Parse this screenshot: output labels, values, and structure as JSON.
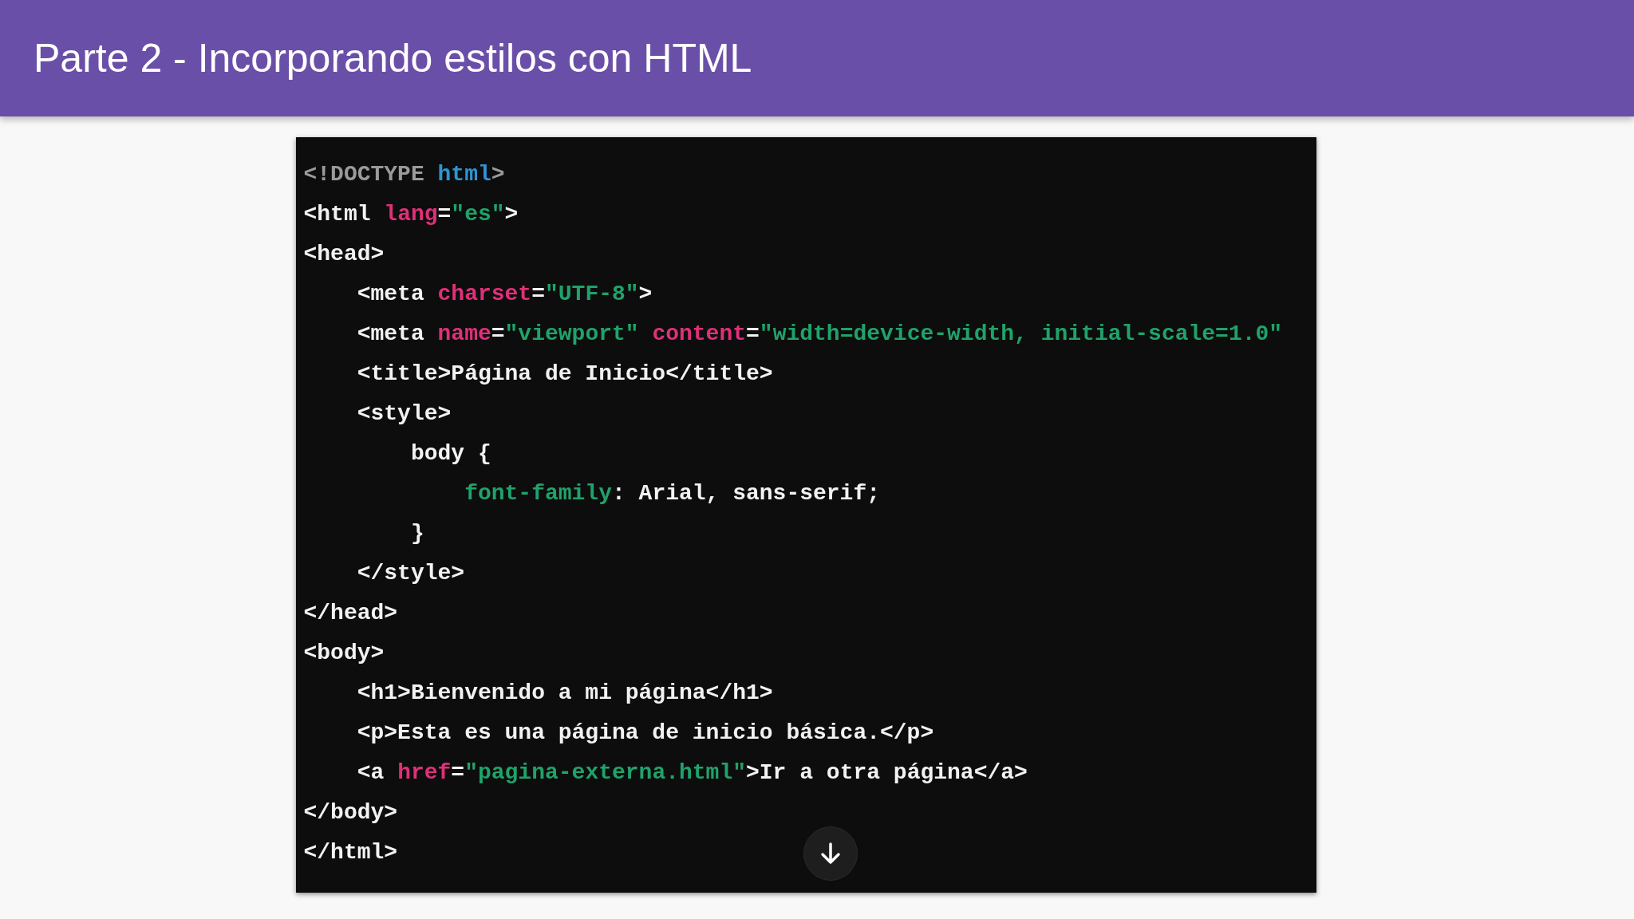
{
  "header": {
    "title": "Parte 2 - Incorporando estilos con HTML"
  },
  "code": {
    "lines": [
      [
        {
          "kind": "doctype",
          "text": "<!DOCTYPE "
        },
        {
          "kind": "keyword",
          "text": "html"
        },
        {
          "kind": "doctype",
          "text": ">"
        }
      ],
      [
        {
          "kind": "tag",
          "text": "<html "
        },
        {
          "kind": "attr",
          "text": "lang"
        },
        {
          "kind": "tag",
          "text": "="
        },
        {
          "kind": "string",
          "text": "\"es\""
        },
        {
          "kind": "tag",
          "text": ">"
        }
      ],
      [
        {
          "kind": "tag",
          "text": "<head>"
        }
      ],
      [
        {
          "kind": "tag",
          "text": "    <meta "
        },
        {
          "kind": "attr",
          "text": "charset"
        },
        {
          "kind": "tag",
          "text": "="
        },
        {
          "kind": "string",
          "text": "\"UTF-8\""
        },
        {
          "kind": "tag",
          "text": ">"
        }
      ],
      [
        {
          "kind": "tag",
          "text": "    <meta "
        },
        {
          "kind": "attr",
          "text": "name"
        },
        {
          "kind": "tag",
          "text": "="
        },
        {
          "kind": "string",
          "text": "\"viewport\""
        },
        {
          "kind": "attr",
          "text": " content"
        },
        {
          "kind": "tag",
          "text": "="
        },
        {
          "kind": "string",
          "text": "\"width=device-width, initial-scale=1.0\""
        }
      ],
      [
        {
          "kind": "tag",
          "text": "    <title>Página de Inicio</title>"
        }
      ],
      [
        {
          "kind": "tag",
          "text": "    <style>"
        }
      ],
      [
        {
          "kind": "tag",
          "text": "        body {"
        }
      ],
      [
        {
          "kind": "property",
          "text": "            font-family"
        },
        {
          "kind": "tag",
          "text": ": Arial, sans-serif;"
        }
      ],
      [
        {
          "kind": "tag",
          "text": "        }"
        }
      ],
      [
        {
          "kind": "tag",
          "text": "    </style>"
        }
      ],
      [
        {
          "kind": "tag",
          "text": "</head>"
        }
      ],
      [
        {
          "kind": "tag",
          "text": "<body>"
        }
      ],
      [
        {
          "kind": "tag",
          "text": "    <h1>Bienvenido a mi página</h1>"
        }
      ],
      [
        {
          "kind": "tag",
          "text": "    <p>Esta es una página de inicio básica.</p>"
        }
      ],
      [
        {
          "kind": "tag",
          "text": "    <a "
        },
        {
          "kind": "attr",
          "text": "href"
        },
        {
          "kind": "tag",
          "text": "="
        },
        {
          "kind": "string",
          "text": "\"pagina-externa.html\""
        },
        {
          "kind": "tag",
          "text": ">Ir a otra página</a>"
        }
      ],
      [
        {
          "kind": "tag",
          "text": "</body>"
        }
      ],
      [
        {
          "kind": "tag",
          "text": "</html>"
        }
      ]
    ]
  }
}
